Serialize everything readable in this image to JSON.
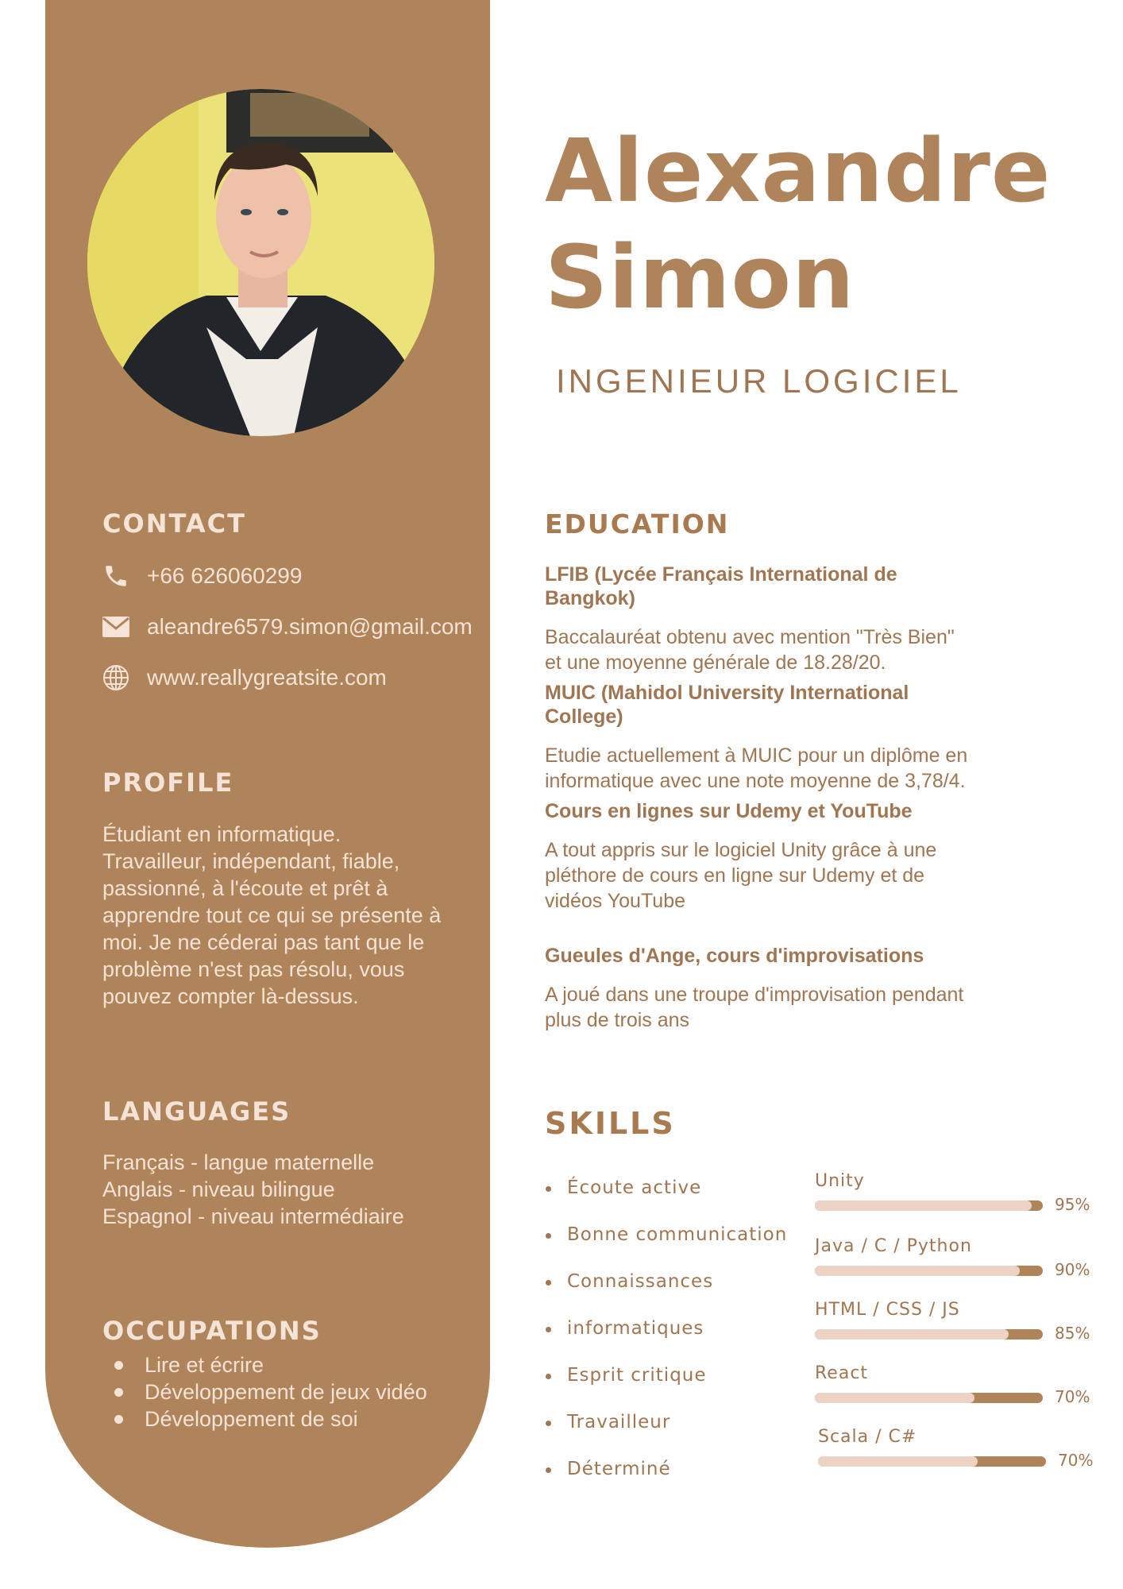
{
  "person": {
    "first_name": "Alexandre",
    "last_name": "Simon",
    "role": "INGENIEUR LOGICIEL"
  },
  "contact": {
    "heading": "CONTACT",
    "phone": "+66 626060299",
    "email": "aleandre6579.simon@gmail.com",
    "website": "www.reallygreatsite.com"
  },
  "profile": {
    "heading": "PROFILE",
    "text": "Étudiant en informatique. Travailleur, indépendant, fiable, passionné, à l'écoute et prêt à apprendre tout ce qui se présente à moi. Je ne céderai pas tant que le problème n'est pas résolu, vous pouvez compter là-dessus."
  },
  "languages": {
    "heading": "LANGUAGES",
    "items": [
      "Français - langue maternelle",
      "Anglais - niveau bilingue",
      "Espagnol - niveau intermédiaire"
    ]
  },
  "occupations": {
    "heading": "OCCUPATIONS",
    "items": [
      "Lire et écrire",
      "Développement de jeux vidéo",
      "Développement de soi"
    ]
  },
  "education": {
    "heading": "EDUCATION",
    "items": [
      {
        "title": "LFIB (Lycée Français International de Bangkok)",
        "desc": "Baccalauréat obtenu avec mention \"Très Bien\"\net une moyenne générale de 18.28/20."
      },
      {
        "title": "MUIC (Mahidol University International College)",
        "desc": "Etudie actuellement à MUIC pour un diplôme en\ninformatique avec une note moyenne de 3,78/4."
      },
      {
        "title": "Cours en lignes sur Udemy et YouTube",
        "desc": "A tout appris sur le logiciel Unity grâce à une\npléthore de cours en ligne sur Udemy  et de\nvidéos YouTube"
      },
      {
        "title": "Gueules d'Ange, cours d'improvisations",
        "desc": "A joué dans une troupe d'improvisation pendant\nplus de trois ans"
      }
    ]
  },
  "skills": {
    "heading": "SKILLS",
    "soft": [
      "Écoute active",
      "Bonne communication",
      "Connaissances",
      "informatiques",
      "Esprit critique",
      "Travailleur",
      "Déterminé"
    ],
    "bars": [
      {
        "label": "Unity",
        "percent": 95,
        "percent_text": "95%"
      },
      {
        "label": "Java / C / Python",
        "percent": 90,
        "percent_text": "90%"
      },
      {
        "label": "HTML / CSS / JS",
        "percent": 85,
        "percent_text": "85%"
      },
      {
        "label": "React",
        "percent": 70,
        "percent_text": "70%"
      },
      {
        "label": "Scala / C#",
        "percent": 70,
        "percent_text": "70%"
      }
    ]
  },
  "colors": {
    "accent": "#b0845b",
    "light": "#f4e3d6",
    "bar_light": "#edd3c5",
    "text_brown": "#a07552"
  }
}
